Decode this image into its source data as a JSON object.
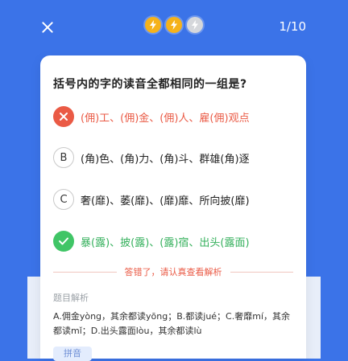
{
  "header": {
    "progress": "1/10",
    "energy": [
      {
        "icon": "lightning-icon",
        "state": "active",
        "color": "#f5b21b"
      },
      {
        "icon": "lightning-icon",
        "state": "active",
        "color": "#f5b21b"
      },
      {
        "icon": "lightning-icon",
        "state": "inactive",
        "color": "#d5d7db"
      }
    ]
  },
  "question": {
    "text": "括号内的字的读音全都相同的一组是?"
  },
  "options": [
    {
      "marker": "close-icon",
      "text": "(佣)工、(佣)金、(佣)人、雇(佣)观点",
      "state": "wrong"
    },
    {
      "marker": "B",
      "text": "(角)色、(角)力、(角)斗、群雄(角)逐",
      "state": "normal"
    },
    {
      "marker": "C",
      "text": "奢(靡)、萎(靡)、(靡)靡、所向披(靡)",
      "state": "normal"
    },
    {
      "marker": "check-icon",
      "text": "暴(露)、披(露)、(露)宿、出头(露面)",
      "state": "correct"
    }
  ],
  "feedback": "答错了，请认真查看解析",
  "analysis": {
    "title": "题目解析",
    "text": "A.佣金yòng，其余都读yōng；B.都读jué；C.奢靡mí，其余都读mǐ；D.出头露面lòu，其余都读lù",
    "chip": "拼音"
  },
  "colors": {
    "background": "#3b73e8",
    "wrong": "#ea5a45",
    "correct": "#40c566",
    "chip_bg": "#e3ecfd"
  }
}
